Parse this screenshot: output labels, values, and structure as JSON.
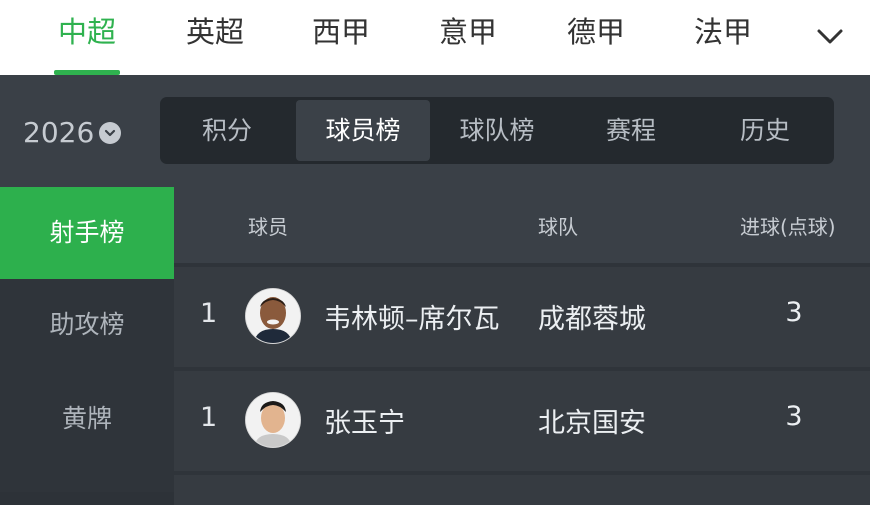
{
  "leagues": {
    "tabs": [
      {
        "label": "中超"
      },
      {
        "label": "英超"
      },
      {
        "label": "西甲"
      },
      {
        "label": "意甲"
      },
      {
        "label": "德甲"
      },
      {
        "label": "法甲"
      }
    ],
    "active_index": 0,
    "more_icon": "chevron-down-icon"
  },
  "season": {
    "year": "2026",
    "icon": "chevron-down-circle-icon"
  },
  "sections": {
    "tabs": [
      {
        "label": "积分"
      },
      {
        "label": "球员榜"
      },
      {
        "label": "球队榜"
      },
      {
        "label": "赛程"
      },
      {
        "label": "历史"
      }
    ],
    "active_index": 1
  },
  "categories": {
    "items": [
      {
        "label": "射手榜"
      },
      {
        "label": "助攻榜"
      },
      {
        "label": "黄牌"
      }
    ],
    "active_index": 0
  },
  "table": {
    "headers": {
      "player": "球员",
      "team": "球队",
      "goals": "进球(点球)"
    },
    "rows": [
      {
        "rank": "1",
        "player": "韦林顿–席尔瓦",
        "team": "成都蓉城",
        "goals": "3"
      },
      {
        "rank": "1",
        "player": "张玉宁",
        "team": "北京国安",
        "goals": "3"
      }
    ]
  },
  "colors": {
    "accent": "#2fb24f",
    "background": "#2d3238",
    "header": "#ffffff"
  }
}
